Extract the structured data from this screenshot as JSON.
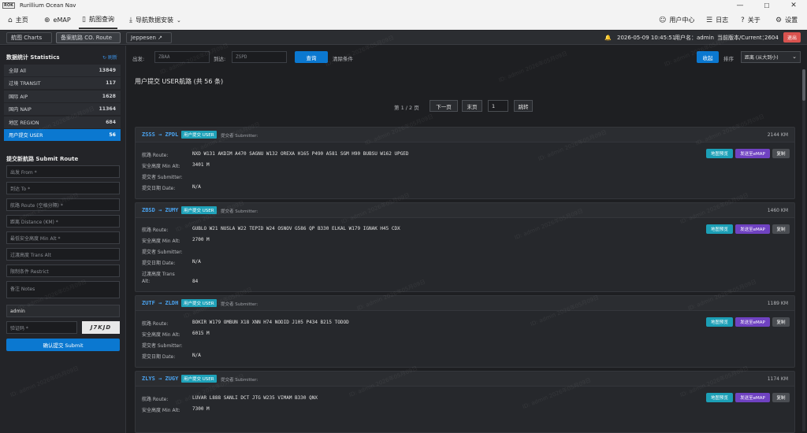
{
  "window": {
    "title": "Rurillium Ocean Nav",
    "logo_text": "ROK"
  },
  "menu": {
    "home": "主页",
    "emap": "eMAP",
    "chart_query": "航图查询",
    "nav_install": "导航数据安装",
    "user_center": "用户中心",
    "log": "日志",
    "about": "关于",
    "settings": "设置"
  },
  "subtabs": {
    "charts": "航图 Charts",
    "co_route": "备案航路 CO. Route",
    "jeppesen": "Jeppesen ↗"
  },
  "status": {
    "datetime": "2026-05-09 10:45:51",
    "user_label": "用户名：",
    "user": "admin",
    "version_label": "当前版本/Current：",
    "version": "2604",
    "logout": "退出"
  },
  "sidebar": {
    "stats_title": "数据统计 Statistics",
    "refresh": "↻ 刷新",
    "stats": [
      {
        "label": "全部 All",
        "count": "13849"
      },
      {
        "label": "过境 TRANSIT",
        "count": "117"
      },
      {
        "label": "国际 AIP",
        "count": "1628"
      },
      {
        "label": "国内 NAIP",
        "count": "11364"
      },
      {
        "label": "地区 REGION",
        "count": "684"
      },
      {
        "label": "用户提交 USER",
        "count": "56"
      }
    ],
    "submit_title": "提交新航路 Submit Route",
    "fields": {
      "from": "出发 From *",
      "to": "到达 To *",
      "route": "航路 Route (空格分隔) *",
      "distance": "距离 Distance (KM) *",
      "min_alt": "最低安全高度 Min Alt *",
      "trans_alt": "过渡高度 Trans Alt",
      "restrict": "限制条件 Restrict",
      "notes": "备注 Notes",
      "submitter": "admin",
      "captcha": "验证码 *",
      "captcha_code": "J7KJD"
    },
    "submit_button": "确认提交 Submit"
  },
  "filter": {
    "from_label": "出发:",
    "from_placeholder": "ZBAA",
    "to_label": "到达:",
    "to_placeholder": "ZSPD",
    "query": "查询",
    "clear": "清除条件",
    "collapse": "收起",
    "sort_label": "排序",
    "sort_value": "距离 (从大到小)"
  },
  "list_title": "用户提交 USER航路 (共 56 条)",
  "pager": {
    "text": "第 1 / 2 页",
    "next": "下一页",
    "last": "末页",
    "page_input": "1",
    "jump": "跳转"
  },
  "labels": {
    "badge": "用户提交 USER",
    "submitter_head": "提交者 Submitter:",
    "route": "航路 Route:",
    "min_alt": "安全高度 Min Alt:",
    "submitter": "提交者 Submitter:",
    "date": "提交日期 Date:",
    "trans_alt": "过渡高度 Trans",
    "trans_alt_2": "Alt:",
    "preview": "地图预览",
    "send_emap": "发送至eMAP",
    "copy": "复制"
  },
  "routes": [
    {
      "pair": "ZSSS → ZPDL",
      "distance": "2144 KM",
      "route": "NXD W131 AKDIM A470 SAGNU W132 OREXA H165 P490 A581 SGM H90 BUBSU W162 UPGED",
      "min_alt": "3401 M",
      "submitter": "",
      "date": "N/A"
    },
    {
      "pair": "ZBSD → ZUMY",
      "distance": "1460 KM",
      "route": "GUBLO W21 NUSLA W22 TEPID W24 OSNOV G586 QP B330 ELKAL W179 IGNAK H45 CDX",
      "min_alt": "2700 M",
      "submitter": "",
      "date": "N/A",
      "trans_alt": "84"
    },
    {
      "pair": "ZUTF → ZLDH",
      "distance": "1189 KM",
      "route": "BOKIR W179 OMBUN X18 XNN H74 NODID J105 P434 B215 TODOD",
      "min_alt": "6015 M",
      "submitter": "",
      "date": "N/A"
    },
    {
      "pair": "ZLYS → ZUGY",
      "distance": "1174 KM",
      "route": "LUVAR L888 SANLI DCT JTG W235 VIMAM B330 QNX",
      "min_alt": "7300 M"
    }
  ],
  "watermark": "ID: admin 2026年05月09日",
  "colors": {
    "accent": "#0b78d0",
    "badge": "#1ea1b8",
    "emap": "#6f42c1",
    "danger": "#d9534f"
  }
}
